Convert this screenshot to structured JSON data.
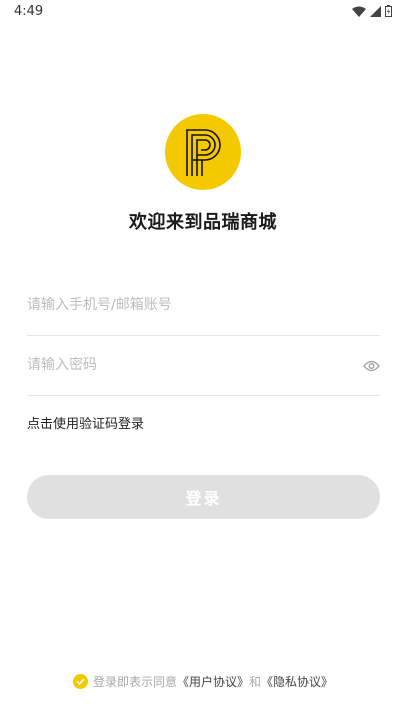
{
  "status_bar": {
    "time": "4:49"
  },
  "brand": {
    "welcome": "欢迎来到品瑞商城",
    "logo_color": "#f5c900"
  },
  "form": {
    "account_placeholder": "请输入手机号/邮箱账号",
    "password_placeholder": "请输入密码",
    "sms_login_link": "点击使用验证码登录",
    "login_button": "登录"
  },
  "agreement": {
    "prefix": "登录即表示同意",
    "user_agreement": "《用户协议》",
    "conjunction": "和",
    "privacy_policy": "《隐私协议》",
    "checked": true
  },
  "colors": {
    "accent": "#f5c900",
    "button_disabled": "#e0e0e0",
    "placeholder": "#bdbdbd"
  }
}
